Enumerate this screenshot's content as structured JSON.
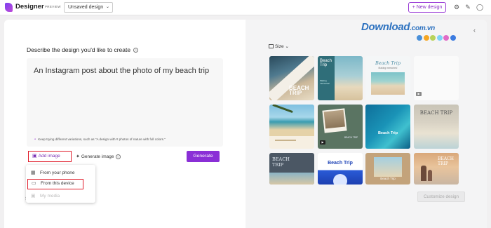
{
  "header": {
    "app_name": "Designer",
    "preview_badge": "PREVIEW",
    "design_name": "Unsaved design",
    "new_design": "+ New design"
  },
  "prompt": {
    "title": "Describe the design you'd like to create",
    "text": "An Instagram post about the photo of my beach trip",
    "hint": "Keep trying different variations, such as \"A design with # photos of nature with full colors.\"",
    "add_image": "Add image",
    "generate_image": "Generate image",
    "generate": "Generate"
  },
  "add_image_menu": {
    "items": [
      {
        "label": "From your phone",
        "icon": "qr-icon",
        "state": "normal"
      },
      {
        "label": "From this device",
        "icon": "monitor-icon",
        "state": "highlighted"
      },
      {
        "label": "My media",
        "icon": "media-icon",
        "state": "disabled"
      }
    ],
    "partial_text_behind": "S"
  },
  "right_panel": {
    "size_label": "Size",
    "customize": "Customize design",
    "watermark": "Download",
    "watermark_domain": ".com.vn",
    "watermark_dot_colors": [
      "#4a90d9",
      "#f5a623",
      "#b8d35a",
      "#7ed3f7",
      "#e06cc7",
      "#3c7be0"
    ],
    "templates": [
      {
        "title": "BEACH TRIP",
        "subtitle": "",
        "style": "photo-diagonal"
      },
      {
        "title": "Beach Trip",
        "subtitle": "Making memories!",
        "style": "teal-split"
      },
      {
        "title": "Beach Trip",
        "subtitle": "Making memories!",
        "style": "light-script"
      },
      {
        "title": "",
        "subtitle": "",
        "style": "blank-video"
      },
      {
        "title": "",
        "subtitle": "",
        "style": "palm-photo"
      },
      {
        "title": "",
        "subtitle": "BEACH TRIP",
        "style": "green-polaroid"
      },
      {
        "title": "Beach Trip",
        "subtitle": "",
        "style": "aerial-ocean"
      },
      {
        "title": "BEACH TRIP",
        "subtitle": "",
        "style": "grey-sand"
      },
      {
        "title": "BEACH TRIP",
        "subtitle": "",
        "style": "slate-photo"
      },
      {
        "title": "Beach Trip",
        "subtitle": "",
        "style": "blue-moon"
      },
      {
        "title": "Beach Trip",
        "subtitle": "",
        "style": "wood-frame"
      },
      {
        "title": "BEACH TRIP",
        "subtitle": "",
        "style": "family-sunset"
      }
    ]
  }
}
